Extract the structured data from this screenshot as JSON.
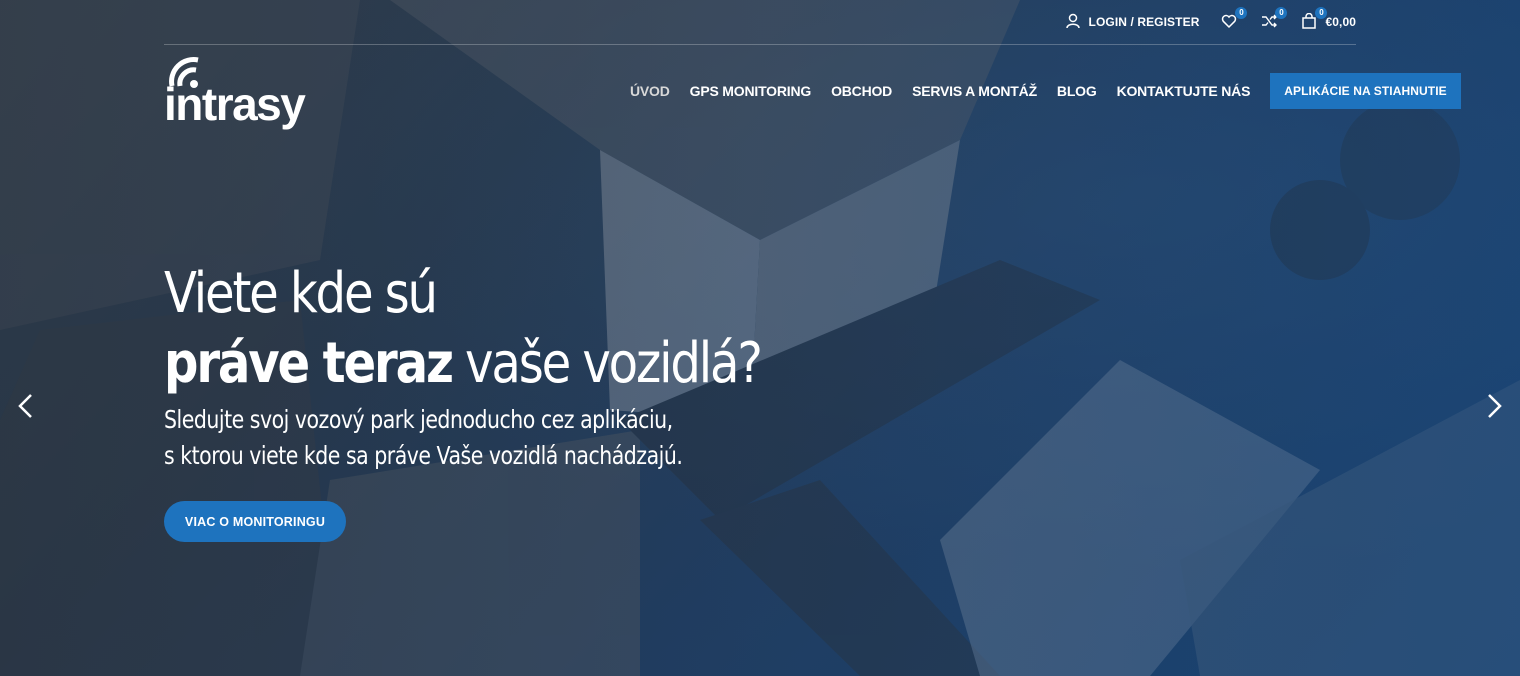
{
  "colors": {
    "accent": "#1e73be",
    "text": "#ffffff"
  },
  "topbar": {
    "login": "LOGIN / REGISTER",
    "wishlist_count": "0",
    "compare_count": "0",
    "cart_count": "0",
    "cart_total": "€0,00"
  },
  "logo": {
    "text": "intrasy",
    "icon": "signal-waves-icon"
  },
  "nav": {
    "items": [
      {
        "label": "ÚVOD",
        "active": true
      },
      {
        "label": "GPS MONITORING"
      },
      {
        "label": "OBCHOD"
      },
      {
        "label": "SERVIS A MONTÁŽ"
      },
      {
        "label": "BLOG"
      },
      {
        "label": "KONTAKTUJTE NÁS"
      }
    ],
    "cta": "APLIKÁCIE NA STIAHNUTIE"
  },
  "hero": {
    "line1": "Viete kde sú",
    "line2_bold": "práve teraz",
    "line2_rest": " vaše vozidlá?",
    "sub1": "Sledujte svoj vozový park jednoducho cez aplikáciu,",
    "sub2": "s ktorou viete kde sa práve Vaše vozidlá nachádzajú.",
    "cta": "VIAC O MONITORINGU"
  },
  "slider": {
    "prev_icon": "chevron-left-icon",
    "next_icon": "chevron-right-icon"
  }
}
